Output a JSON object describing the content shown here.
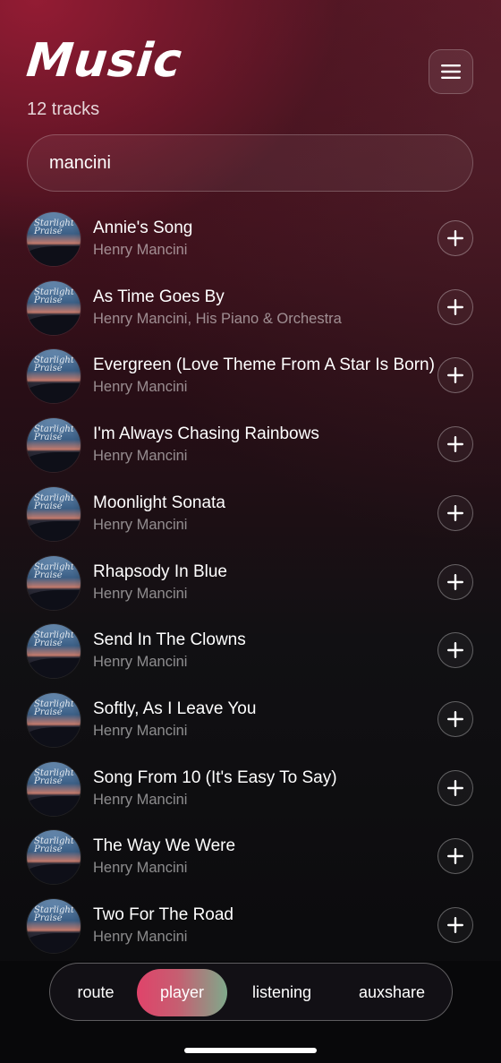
{
  "header": {
    "title": "Music",
    "track_count": "12 tracks",
    "menu_icon": "hamburger-menu-icon"
  },
  "search": {
    "value": "mancini",
    "placeholder": ""
  },
  "tracks": [
    {
      "title": "Annie's Song",
      "artist": "Henry Mancini"
    },
    {
      "title": "As Time Goes By",
      "artist": "Henry Mancini, His Piano & Orchestra"
    },
    {
      "title": "Evergreen (Love Theme From A Star Is Born)",
      "artist": "Henry Mancini"
    },
    {
      "title": "I'm Always Chasing Rainbows",
      "artist": "Henry Mancini"
    },
    {
      "title": "Moonlight Sonata",
      "artist": "Henry Mancini"
    },
    {
      "title": "Rhapsody In Blue",
      "artist": "Henry Mancini"
    },
    {
      "title": "Send In The Clowns",
      "artist": "Henry Mancini"
    },
    {
      "title": "Softly, As I Leave You",
      "artist": "Henry Mancini"
    },
    {
      "title": "Song From 10 (It's Easy To Say)",
      "artist": "Henry Mancini"
    },
    {
      "title": "The Way We Were",
      "artist": "Henry Mancini"
    },
    {
      "title": "Two For The Road",
      "artist": "Henry Mancini"
    }
  ],
  "album_art_text": "Starlight Praise",
  "nav": {
    "items": [
      {
        "label": "route"
      },
      {
        "label": "player"
      },
      {
        "label": "listening"
      },
      {
        "label": "auxshare"
      }
    ],
    "active": "player"
  },
  "colors": {
    "accent_gradient_start": "#e0436a",
    "accent_gradient_end": "#7fa98b",
    "header_glow": "#961c34"
  }
}
